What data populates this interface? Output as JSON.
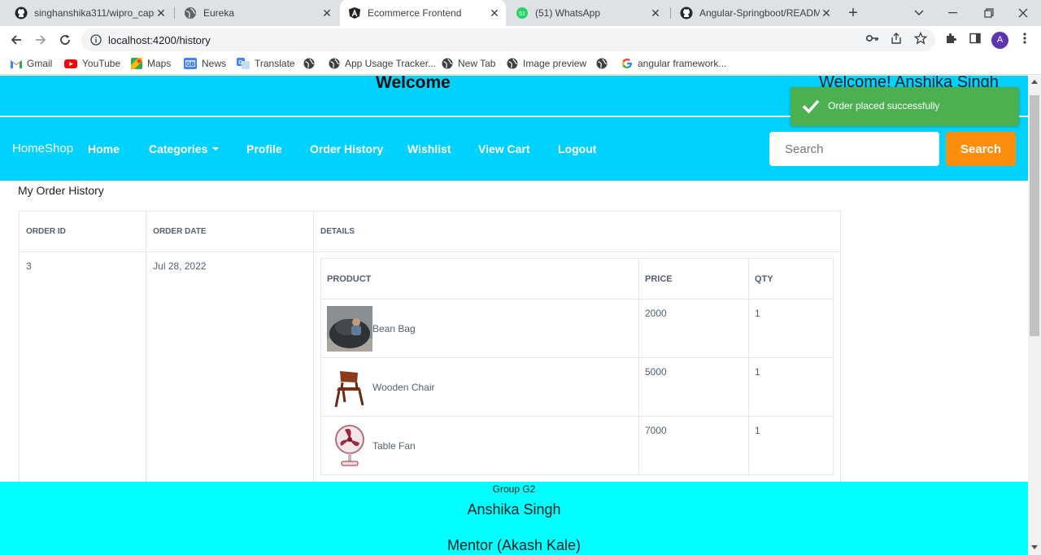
{
  "browser": {
    "tabs": [
      {
        "title": "singhanshika311/wipro_caps",
        "icon": "github-icon"
      },
      {
        "title": "Eureka",
        "icon": "globe-icon"
      },
      {
        "title": "Ecommerce Frontend",
        "icon": "angular-icon"
      },
      {
        "title": "(51) WhatsApp",
        "icon": "whatsapp-icon"
      },
      {
        "title": "Angular-Springboot/READM",
        "icon": "github-icon"
      }
    ],
    "url": "localhost:4200/history",
    "profile_initial": "A",
    "bookmarks": [
      {
        "label": "Gmail",
        "icon": "gmail-icon"
      },
      {
        "label": "YouTube",
        "icon": "youtube-icon"
      },
      {
        "label": "Maps",
        "icon": "maps-icon"
      },
      {
        "label": "News",
        "icon": "news-icon"
      },
      {
        "label": "Translate",
        "icon": "translate-icon"
      },
      {
        "label": "",
        "icon": "globe-icon"
      },
      {
        "label": "App Usage Tracker...",
        "icon": "globe-icon"
      },
      {
        "label": "New Tab",
        "icon": "globe-icon"
      },
      {
        "label": "Image preview",
        "icon": "globe-icon"
      },
      {
        "label": "",
        "icon": "globe-icon"
      },
      {
        "label": "angular framework...",
        "icon": "google-icon"
      }
    ]
  },
  "header": {
    "title": "Welcome",
    "user_greeting": "Welcome! Anshika Singh"
  },
  "toast": {
    "message": "Order placed successfully"
  },
  "nav": {
    "brand": "HomeShop",
    "links": [
      "Home",
      "Categories",
      "Profile",
      "Order History",
      "Wishlist",
      "View Cart",
      "Logout"
    ],
    "search_placeholder": "Search",
    "search_button": "Search"
  },
  "history": {
    "heading": "My Order History",
    "columns": [
      "ORDER ID",
      "ORDER DATE",
      "DETAILS"
    ],
    "order": {
      "id": "3",
      "date": "Jul 28, 2022",
      "item_columns": [
        "PRODUCT",
        "PRICE",
        "QTY"
      ],
      "items": [
        {
          "product": "Bean Bag",
          "price": "2000",
          "qty": "1"
        },
        {
          "product": "Wooden Chair",
          "price": "5000",
          "qty": "1"
        },
        {
          "product": "Table Fan",
          "price": "7000",
          "qty": "1"
        }
      ]
    }
  },
  "footer": {
    "group": "Group G2",
    "name": "Anshika Singh",
    "mentor": "Mentor (Akash Kale)"
  },
  "colors": {
    "header_bg": "#00d2ff",
    "search_button_bg": "#fd8d0c",
    "toast_bg": "#4caf50",
    "footer_bg": "#00ffff"
  }
}
